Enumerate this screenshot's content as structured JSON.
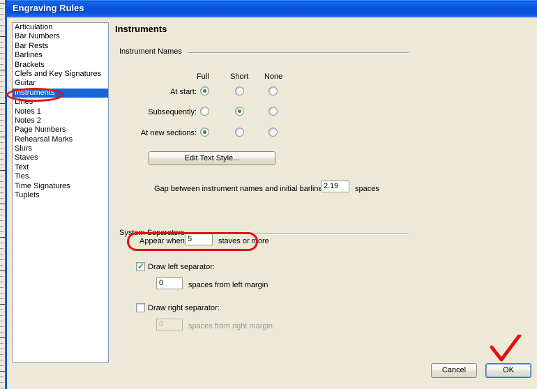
{
  "window": {
    "title": "Engraving Rules"
  },
  "categories": {
    "items": [
      {
        "label": "Articulation",
        "selected": false
      },
      {
        "label": "Bar Numbers",
        "selected": false
      },
      {
        "label": "Bar Rests",
        "selected": false
      },
      {
        "label": "Barlines",
        "selected": false
      },
      {
        "label": "Brackets",
        "selected": false
      },
      {
        "label": "Clefs and Key Signatures",
        "selected": false
      },
      {
        "label": "Guitar",
        "selected": false
      },
      {
        "label": "Instruments",
        "selected": true
      },
      {
        "label": "Lines",
        "selected": false
      },
      {
        "label": "Notes 1",
        "selected": false
      },
      {
        "label": "Notes 2",
        "selected": false
      },
      {
        "label": "Page Numbers",
        "selected": false
      },
      {
        "label": "Rehearsal Marks",
        "selected": false
      },
      {
        "label": "Slurs",
        "selected": false
      },
      {
        "label": "Staves",
        "selected": false
      },
      {
        "label": "Text",
        "selected": false
      },
      {
        "label": "Ties",
        "selected": false
      },
      {
        "label": "Time Signatures",
        "selected": false
      },
      {
        "label": "Tuplets",
        "selected": false
      }
    ]
  },
  "pane": {
    "title": "Instruments"
  },
  "instrument_names": {
    "group_label": "Instrument Names",
    "columns": [
      "Full",
      "Short",
      "None"
    ],
    "rows": [
      {
        "label": "At start:",
        "selected": "Full"
      },
      {
        "label": "Subsequently:",
        "selected": "Short"
      },
      {
        "label": "At new sections:",
        "selected": "Full"
      }
    ],
    "edit_text_style_button": "Edit Text Style...",
    "gap_label": "Gap between instrument names and initial barline",
    "gap_value": "2.19",
    "gap_units": "spaces"
  },
  "system_separators": {
    "group_label": "System Separators",
    "appear_when_prefix": "Appear when",
    "appear_when_value": "5",
    "appear_when_suffix": "staves or more",
    "draw_left_label": "Draw left separator:",
    "draw_left_checked": true,
    "left_value": "0",
    "left_units": "spaces from left margin",
    "draw_right_label": "Draw right separator:",
    "draw_right_checked": false,
    "right_value": "0",
    "right_units": "spaces from right margin"
  },
  "footer": {
    "cancel_label": "Cancel",
    "ok_label": "OK"
  },
  "annotations": {
    "accent_color": "#e01010",
    "marks": [
      "instruments-list-item-circle",
      "appear-when-rounded-rect",
      "ok-button-checkmark"
    ]
  }
}
